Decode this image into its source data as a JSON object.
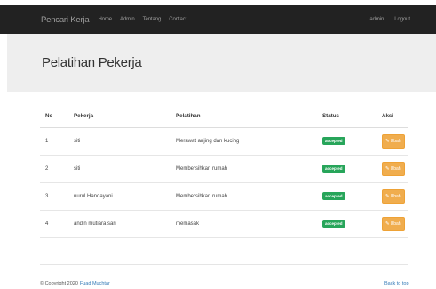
{
  "navbar": {
    "brand": "Pencari Kerja",
    "links": [
      "Home",
      "Admin",
      "Tentang",
      "Contact"
    ],
    "right_links": [
      "admin",
      "Logout"
    ]
  },
  "header": {
    "title": "Pelatihan Pekerja"
  },
  "table": {
    "columns": [
      "No",
      "Pekerja",
      "Pelatihan",
      "Status",
      "Aksi"
    ],
    "rows": [
      {
        "no": "1",
        "pekerja": "siti",
        "pelatihan": "Merawat anjing dan kucing",
        "status": "accepted",
        "action": "Ubah"
      },
      {
        "no": "2",
        "pekerja": "siti",
        "pelatihan": "Membersihkan rumah",
        "status": "accepted",
        "action": "Ubah"
      },
      {
        "no": "3",
        "pekerja": "nurul Handayani",
        "pelatihan": "Membersihkan rumah",
        "status": "accepted",
        "action": "Ubah"
      },
      {
        "no": "4",
        "pekerja": "andin mutiara sari",
        "pelatihan": "memasak",
        "status": "accepted",
        "action": "Ubah"
      }
    ]
  },
  "footer": {
    "copyright": "© Copyright 2020",
    "author": "Fuad Muchtar",
    "back_to_top": "Back to top"
  },
  "colors": {
    "navbar_bg": "#222222",
    "jumbotron_bg": "#eeeeee",
    "badge_success": "#27a55a",
    "btn_warning": "#f0ad4e",
    "link": "#337ab7"
  },
  "icons": {
    "edit": "edit-icon"
  }
}
